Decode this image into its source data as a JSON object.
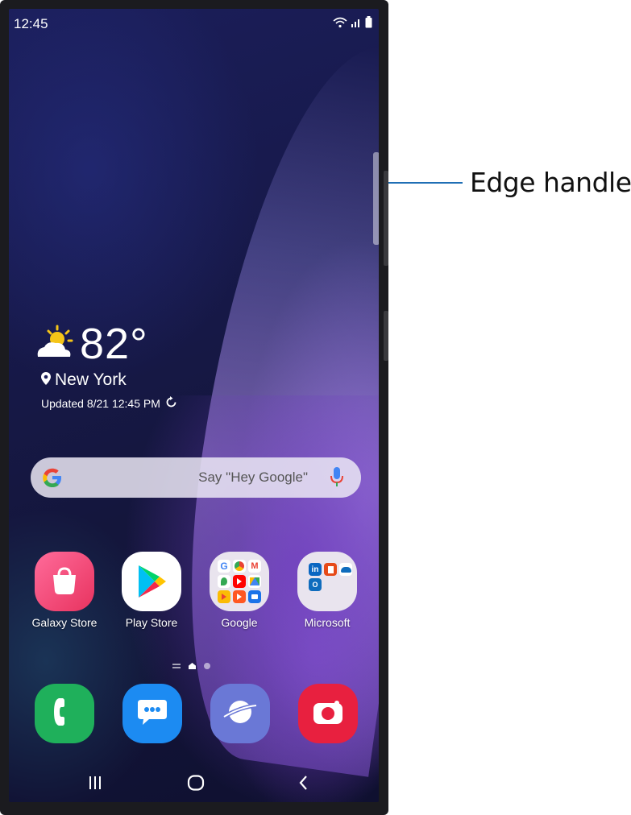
{
  "status_bar": {
    "time": "12:45",
    "icons": [
      "wifi-icon",
      "signal-icon",
      "battery-icon"
    ]
  },
  "weather": {
    "temperature": "82°",
    "icon": "partly-sunny-icon",
    "location": "New York",
    "updated": "Updated 8/21 12:45 PM"
  },
  "search": {
    "placeholder": "Say \"Hey Google\""
  },
  "apps": [
    {
      "label": "Galaxy Store",
      "icon": "galaxy-store-icon",
      "color": "#f0467a"
    },
    {
      "label": "Play Store",
      "icon": "play-store-icon",
      "color": "#ffffff"
    },
    {
      "label": "Google",
      "icon": "google-folder-icon",
      "color": "#e9e4ee"
    },
    {
      "label": "Microsoft",
      "icon": "microsoft-folder-icon",
      "color": "#e9e4ee"
    }
  ],
  "dock": [
    {
      "icon": "phone-icon",
      "color": "#1fb05b"
    },
    {
      "icon": "messages-icon",
      "color": "#1c8bf2"
    },
    {
      "icon": "internet-icon",
      "color": "#6a78d6"
    },
    {
      "icon": "camera-icon",
      "color": "#e8203f"
    }
  ],
  "nav": {
    "recents": "recent-apps-icon",
    "home": "home-icon",
    "back": "back-icon"
  },
  "annotation": {
    "label": "Edge handle",
    "line_color": "#1f6fb5"
  }
}
